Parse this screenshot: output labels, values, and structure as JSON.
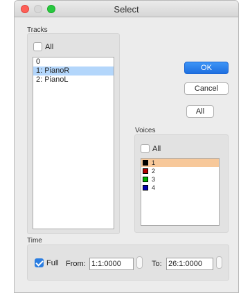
{
  "window": {
    "title": "Select"
  },
  "tracks": {
    "label": "Tracks",
    "all_label": "All",
    "all_checked": false,
    "items": [
      {
        "label": "0",
        "selected": false
      },
      {
        "label": "1: PianoR",
        "selected": true
      },
      {
        "label": "2: PianoL",
        "selected": false
      }
    ]
  },
  "buttons": {
    "ok": "OK",
    "cancel": "Cancel",
    "all": "All"
  },
  "voices": {
    "label": "Voices",
    "all_label": "All",
    "all_checked": false,
    "items": [
      {
        "label": "1",
        "color": "#000000",
        "selected": true
      },
      {
        "label": "2",
        "color": "#b00000",
        "selected": false
      },
      {
        "label": "3",
        "color": "#00b000",
        "selected": false
      },
      {
        "label": "4",
        "color": "#0000b0",
        "selected": false
      }
    ]
  },
  "time": {
    "label": "Time",
    "full_label": "Full",
    "full_checked": true,
    "from_label": "From:",
    "from_value": "1:1:0000",
    "to_label": "To:",
    "to_value": "26:1:0000"
  }
}
